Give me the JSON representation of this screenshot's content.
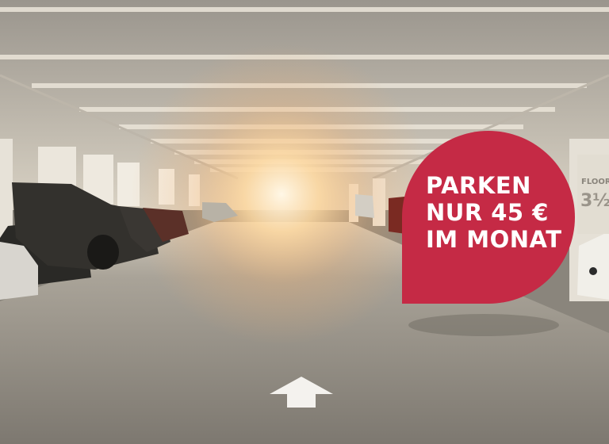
{
  "promo": {
    "lines": [
      "PARKEN",
      "NUR 45 €",
      "IM MONAT"
    ],
    "background_color": "#c52a45",
    "text_color": "#ffffff"
  },
  "floor_sign": {
    "label": "FLOOR",
    "level": "3½"
  },
  "scene": {
    "subject": "underground parking garage",
    "floor_marking": "arrow-up-icon"
  }
}
